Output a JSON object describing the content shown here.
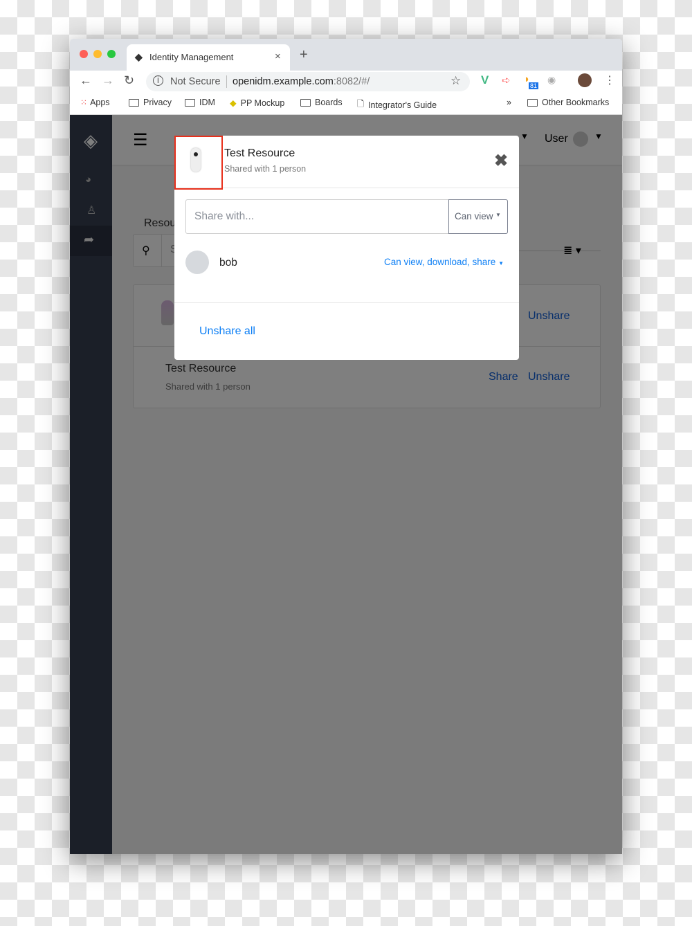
{
  "browser": {
    "tab_title": "Identity Management",
    "url_security": "Not Secure",
    "url_host": "openidm.example.com",
    "url_rest": ":8082/#/",
    "extension_badge": "81",
    "bookmarks": [
      "Apps",
      "Privacy",
      "IDM",
      "PP Mockup",
      "Boards",
      "Integrator's Guide"
    ],
    "overflow": "»",
    "other_bookmarks": "Other Bookmarks"
  },
  "header": {
    "user_label": "User"
  },
  "page": {
    "tab_label": "Resources",
    "search_placeholder": "Search",
    "rows": [
      {
        "title": "",
        "subtitle": "",
        "share": "",
        "unshare": "Unshare"
      },
      {
        "title": "Test Resource",
        "subtitle": "Shared with 1 person",
        "share": "Share",
        "unshare": "Unshare"
      }
    ]
  },
  "modal": {
    "title": "Test Resource",
    "subtitle": "Shared with 1 person",
    "share_placeholder": "Share with...",
    "permission_select": "Can view",
    "shares": [
      {
        "name": "bob",
        "permission": "Can view, download, share"
      }
    ],
    "unshare_all": "Unshare all"
  },
  "colors": {
    "accent": "#0d7ff5",
    "sidebar": "#1b1f2a",
    "highlight": "#e8301c"
  }
}
